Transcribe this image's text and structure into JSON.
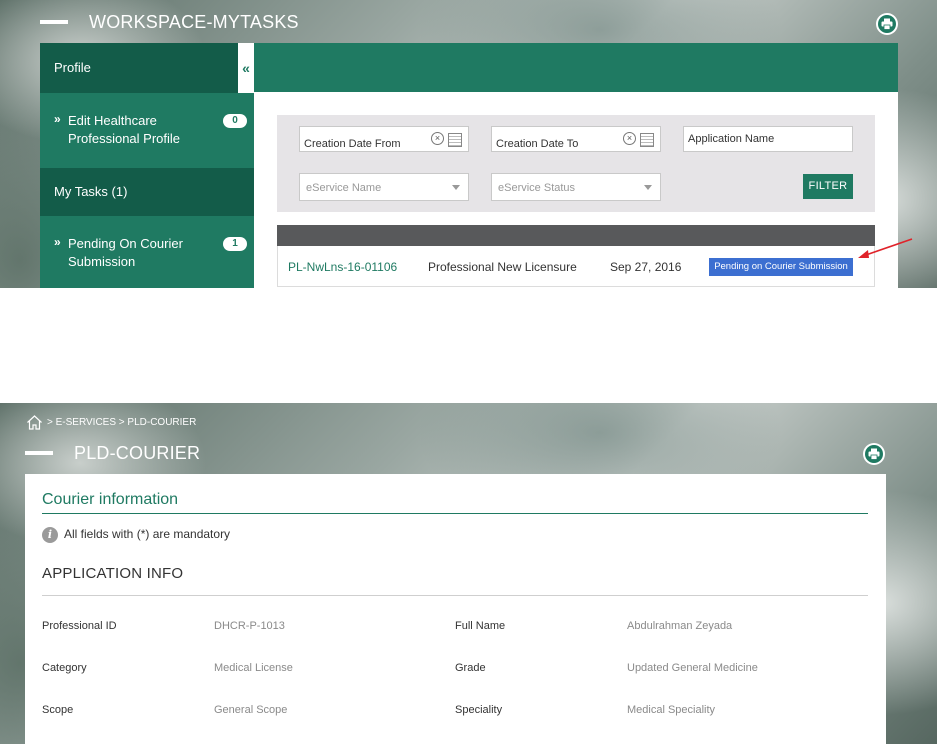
{
  "workspace": {
    "title": "WORKSPACE-MYTASKS",
    "sidebar": {
      "profile_header": "Profile",
      "collapse_icon": "«",
      "edit_profile": {
        "label": "Edit Healthcare Professional Profile",
        "count": "0"
      },
      "my_tasks_header": "My Tasks (1)",
      "pending_courier": {
        "label": "Pending On Courier Submission",
        "count": "1"
      }
    },
    "filters": {
      "creation_date_from": "Creation Date From",
      "creation_date_to": "Creation Date To",
      "application_name": "Application Name",
      "eservice_name": "eService Name",
      "eservice_status": "eService Status",
      "filter_button": "FILTER"
    },
    "table": {
      "rows": [
        {
          "id": "PL-NwLns-16-01106",
          "service": "Professional New Licensure",
          "date": "Sep 27, 2016",
          "status": "Pending on Courier Submission"
        }
      ]
    }
  },
  "courier": {
    "breadcrumb": {
      "sep1": ">",
      "item1": "E-SERVICES",
      "sep2": ">",
      "item2": "PLD-COURIER"
    },
    "title": "PLD-COURIER",
    "section_title": "Courier information",
    "mandatory_note": "All fields with (*) are mandatory",
    "info_icon": "i",
    "app_info_heading": "APPLICATION INFO",
    "fields": {
      "professional_id": {
        "label": "Professional ID",
        "value": "DHCR-P-1013"
      },
      "full_name": {
        "label": "Full Name",
        "value": "Abdulrahman Zeyada"
      },
      "category": {
        "label": "Category",
        "value": "Medical License"
      },
      "grade": {
        "label": "Grade",
        "value": "Updated General Medicine"
      },
      "scope": {
        "label": "Scope",
        "value": "General Scope"
      },
      "speciality": {
        "label": "Speciality",
        "value": "Medical Speciality"
      }
    }
  },
  "colors": {
    "brand_green": "#1f7a62",
    "brand_green_dark": "#135c49",
    "status_blue": "#3c6fd1",
    "arrow_red": "#e0232a"
  },
  "icons": [
    "print-icon",
    "home-icon",
    "calendar-icon",
    "clear-icon",
    "chevron-double-right-icon",
    "chevron-double-left-icon",
    "info-icon",
    "dropdown-arrow-icon"
  ]
}
